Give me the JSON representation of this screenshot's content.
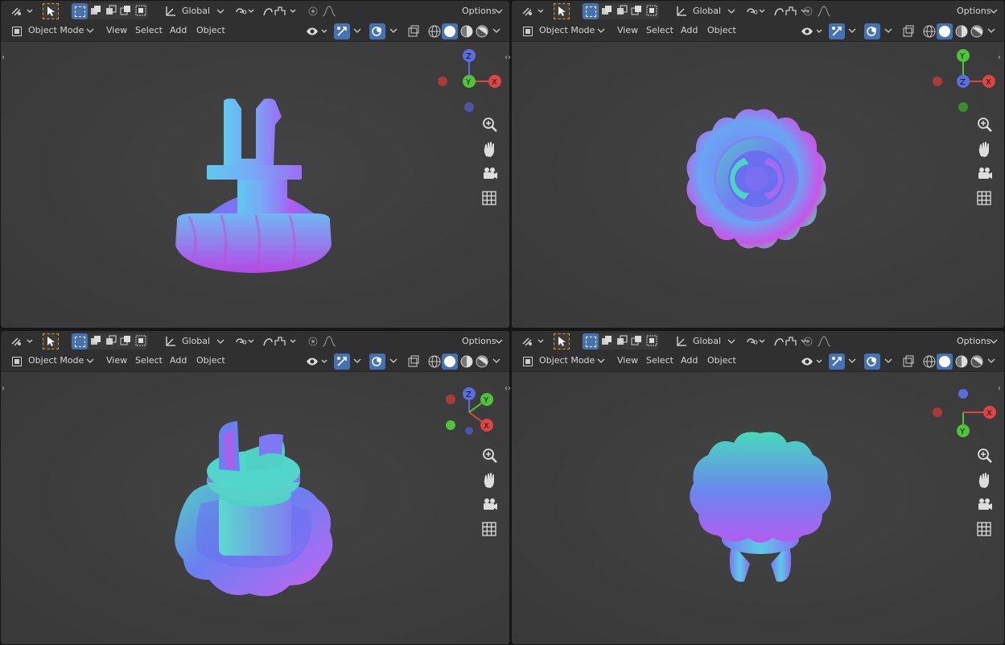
{
  "app": "Blender",
  "viewports": [
    {
      "id": "top-left",
      "mode_label": "Object Mode",
      "menu": [
        "View",
        "Select",
        "Add",
        "Object"
      ],
      "transform_orientation": "Global",
      "options_label": "Options",
      "gizmo": {
        "axes": [
          {
            "label": "Z",
            "color": "#5b6ee1"
          },
          {
            "label": "Y",
            "color": "#4fc43a"
          },
          {
            "label": "X",
            "color": "#e04545"
          }
        ]
      }
    },
    {
      "id": "top-right",
      "mode_label": "Object Mode",
      "menu": [
        "View",
        "Select",
        "Add",
        "Object"
      ],
      "transform_orientation": "Global",
      "options_label": "Options",
      "gizmo": {
        "axes": [
          {
            "label": "Y",
            "color": "#4fc43a"
          },
          {
            "label": "Z",
            "color": "#5b6ee1"
          },
          {
            "label": "X",
            "color": "#e04545"
          }
        ]
      }
    },
    {
      "id": "bottom-left",
      "mode_label": "Object Mode",
      "menu": [
        "View",
        "Select",
        "Add",
        "Object"
      ],
      "transform_orientation": "Global",
      "options_label": "Options",
      "gizmo": {
        "axes": [
          {
            "label": "Z",
            "color": "#5b6ee1"
          },
          {
            "label": "Y",
            "color": "#4fc43a"
          },
          {
            "label": "X",
            "color": "#e04545"
          }
        ]
      }
    },
    {
      "id": "bottom-right",
      "mode_label": "Object Mode",
      "menu": [
        "View",
        "Select",
        "Add",
        "Object"
      ],
      "transform_orientation": "Global",
      "options_label": "Options",
      "gizmo": {
        "axes": [
          {
            "label": "X",
            "color": "#e04545"
          },
          {
            "label": "Y",
            "color": "#4fc43a"
          }
        ]
      }
    }
  ],
  "colors": {
    "accent": "#4672b4",
    "select_outline": "#e59a28",
    "x_axis": "#e04545",
    "y_axis": "#4fc43a",
    "z_axis": "#5b6ee1"
  },
  "icons": [
    "transform-pivot-icon",
    "select-tool-icon",
    "select-mode-icons",
    "orientation-icon",
    "snap-icon",
    "proportional-icon",
    "visibility-icon",
    "gizmo-icon",
    "overlay-icon",
    "xray-icon",
    "shading-icons",
    "zoom-icon",
    "pan-hand-icon",
    "camera-icon",
    "grid-icon"
  ]
}
